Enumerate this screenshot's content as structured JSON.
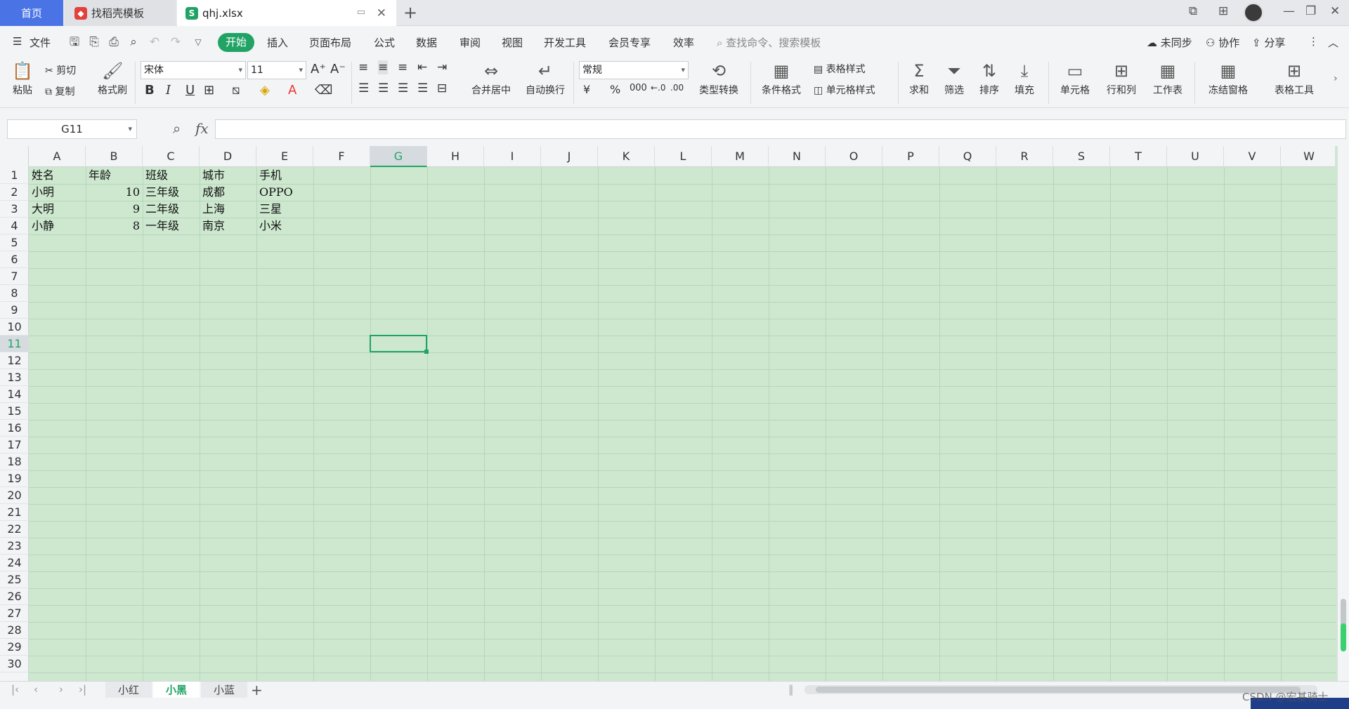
{
  "tabs": {
    "home": "首页",
    "templates": "找稻壳模板",
    "file": "qhj.xlsx"
  },
  "menu": {
    "file": "文件",
    "start": "开始",
    "items": [
      "插入",
      "页面布局",
      "公式",
      "数据",
      "审阅",
      "视图",
      "开发工具",
      "会员专享",
      "效率"
    ],
    "search_placeholder": "查找命令、搜索模板",
    "sync": "未同步",
    "collab": "协作",
    "share": "分享"
  },
  "ribbon": {
    "paste": "粘贴",
    "cut": "剪切",
    "copy": "复制",
    "format_painter": "格式刷",
    "font": "宋体",
    "font_size": "11",
    "merge_center": "合并居中",
    "wrap_text": "自动换行",
    "number_format": "常规",
    "convert_type": "类型转换",
    "conditional_format": "条件格式",
    "table_style": "表格样式",
    "cell_style": "单元格样式",
    "sum": "求和",
    "filter": "筛选",
    "sort": "排序",
    "fill": "填充",
    "cells": "单元格",
    "rows_cols": "行和列",
    "worksheet": "工作表",
    "freeze": "冻结窗格",
    "table_tools": "表格工具"
  },
  "formula_bar": {
    "name_box": "G11",
    "fx": "fx",
    "formula": ""
  },
  "grid": {
    "columns": [
      "A",
      "B",
      "C",
      "D",
      "E",
      "F",
      "G",
      "H",
      "I",
      "J",
      "K",
      "L",
      "M",
      "N",
      "O",
      "P",
      "Q",
      "R",
      "S",
      "T",
      "U",
      "V",
      "W"
    ],
    "rows": [
      "1",
      "2",
      "3",
      "4",
      "5",
      "6",
      "7",
      "8",
      "9",
      "10",
      "11",
      "12",
      "13",
      "14",
      "15",
      "16",
      "17",
      "18",
      "19",
      "20",
      "21",
      "22",
      "23",
      "24",
      "25",
      "26",
      "27",
      "28",
      "29",
      "30"
    ],
    "active_column": "G",
    "active_row": "11",
    "data": [
      [
        "姓名",
        "年龄",
        "班级",
        "城市",
        "手机"
      ],
      [
        "小明",
        "10",
        "三年级",
        "成都",
        "OPPO"
      ],
      [
        "大明",
        "9",
        "二年级",
        "上海",
        "三星"
      ],
      [
        "小静",
        "8",
        "一年级",
        "南京",
        "小米"
      ]
    ],
    "colors": {
      "cell_bg": "#cde8cf",
      "accent": "#21a366"
    }
  },
  "sheets": {
    "tabs": [
      "小红",
      "小黑",
      "小蓝"
    ],
    "active": "小黑"
  },
  "watermark": "CSDN @宏基骑士"
}
